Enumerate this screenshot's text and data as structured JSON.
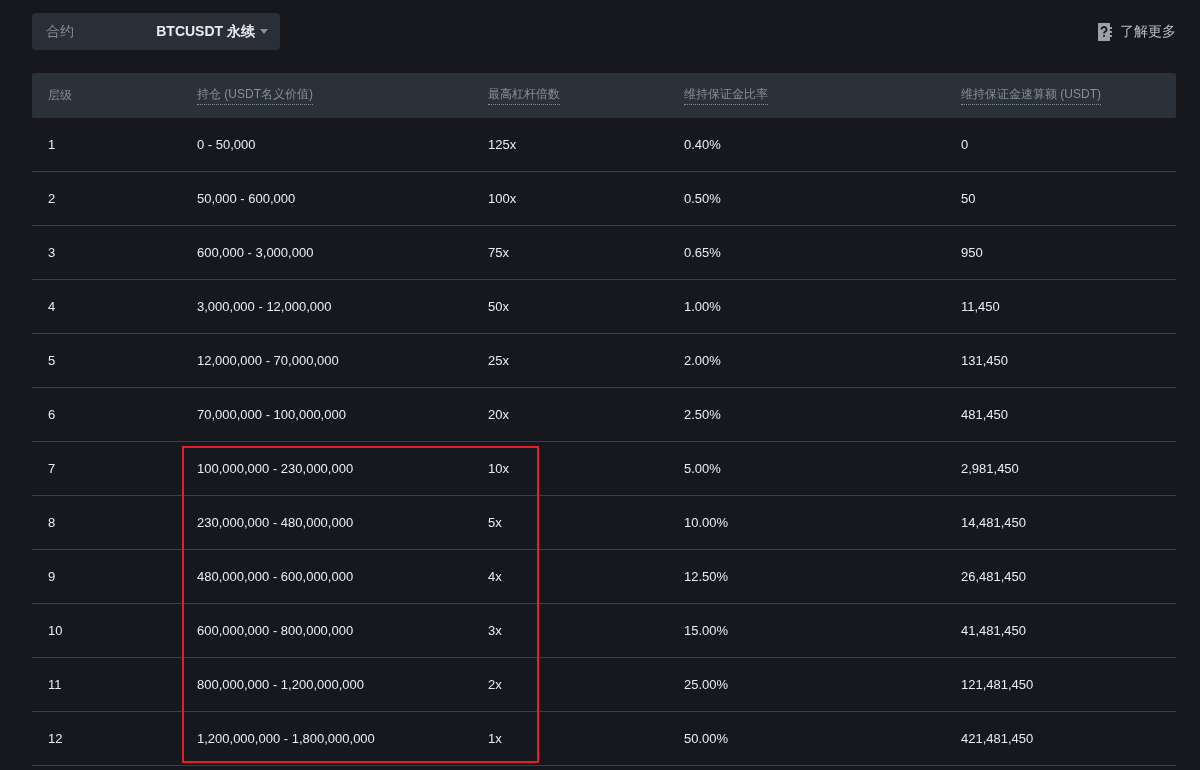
{
  "contract_select": {
    "label": "合约",
    "value": "BTCUSDT 永续"
  },
  "learn_more": {
    "label": "了解更多"
  },
  "table": {
    "columns": [
      "层级",
      "持仓 (USDT名义价值)",
      "最高杠杆倍数",
      "维持保证金比率",
      "维持保证金速算额 (USDT)"
    ],
    "rows": [
      {
        "cells": [
          "1",
          "0 - 50,000",
          "125x",
          "0.40%",
          "0"
        ],
        "highlighted": false
      },
      {
        "cells": [
          "2",
          "50,000 - 600,000",
          "100x",
          "0.50%",
          "50"
        ],
        "highlighted": false
      },
      {
        "cells": [
          "3",
          "600,000 - 3,000,000",
          "75x",
          "0.65%",
          "950"
        ],
        "highlighted": false
      },
      {
        "cells": [
          "4",
          "3,000,000 - 12,000,000",
          "50x",
          "1.00%",
          "11,450"
        ],
        "highlighted": false
      },
      {
        "cells": [
          "5",
          "12,000,000 - 70,000,000",
          "25x",
          "2.00%",
          "131,450"
        ],
        "highlighted": false
      },
      {
        "cells": [
          "6",
          "70,000,000 - 100,000,000",
          "20x",
          "2.50%",
          "481,450"
        ],
        "highlighted": false
      },
      {
        "cells": [
          "7",
          "100,000,000 - 230,000,000",
          "10x",
          "5.00%",
          "2,981,450"
        ],
        "highlighted": true
      },
      {
        "cells": [
          "8",
          "230,000,000 - 480,000,000",
          "5x",
          "10.00%",
          "14,481,450"
        ],
        "highlighted": true
      },
      {
        "cells": [
          "9",
          "480,000,000 - 600,000,000",
          "4x",
          "12.50%",
          "26,481,450"
        ],
        "highlighted": true
      },
      {
        "cells": [
          "10",
          "600,000,000 - 800,000,000",
          "3x",
          "15.00%",
          "41,481,450"
        ],
        "highlighted": true
      },
      {
        "cells": [
          "11",
          "800,000,000 - 1,200,000,000",
          "2x",
          "25.00%",
          "121,481,450"
        ],
        "highlighted": true
      },
      {
        "cells": [
          "12",
          "1,200,000,000 - 1,800,000,000",
          "1x",
          "50.00%",
          "421,481,450"
        ],
        "highlighted": true
      }
    ]
  }
}
